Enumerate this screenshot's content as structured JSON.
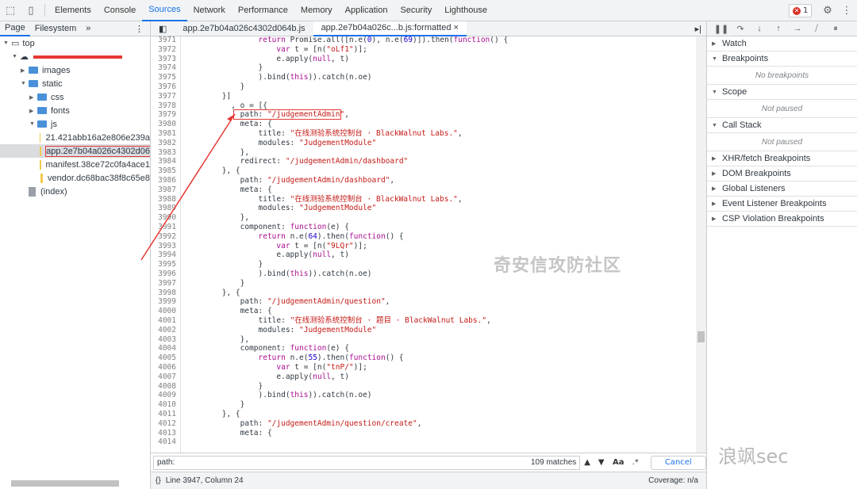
{
  "toolbar": {
    "tabs": [
      "Elements",
      "Console",
      "Sources",
      "Network",
      "Performance",
      "Memory",
      "Application",
      "Security",
      "Lighthouse"
    ],
    "active": "Sources",
    "error_count": "1"
  },
  "navigator": {
    "tabs": [
      "Page",
      "Filesystem"
    ],
    "more": "»",
    "tree": [
      {
        "label": "top",
        "type": "root",
        "depth": 0
      },
      {
        "label": "",
        "type": "folder-cloud",
        "depth": 1,
        "redacted": true
      },
      {
        "label": "images",
        "type": "folder",
        "depth": 2
      },
      {
        "label": "static",
        "type": "folder",
        "depth": 2
      },
      {
        "label": "css",
        "type": "folder",
        "depth": 3
      },
      {
        "label": "fonts",
        "type": "folder",
        "depth": 3
      },
      {
        "label": "js",
        "type": "folder",
        "depth": 3
      },
      {
        "label": "21.421abb16a2e806e239a",
        "type": "file",
        "depth": 4
      },
      {
        "label": "app.2e7b04a026c4302d06",
        "type": "file",
        "depth": 4,
        "selected": true
      },
      {
        "label": "manifest.38ce72c0fa4ace1",
        "type": "file",
        "depth": 4
      },
      {
        "label": "vendor.dc68bac38f8c65e8",
        "type": "file",
        "depth": 4
      },
      {
        "label": "(index)",
        "type": "file-gray",
        "depth": 2
      }
    ]
  },
  "editor": {
    "tabs": [
      {
        "label": "app.2e7b04a026c4302d064b.js",
        "active": false
      },
      {
        "label": "app.2e7b04a026c...b.js:formatted",
        "active": true,
        "close": "×"
      }
    ],
    "lines": [
      {
        "n": "3971",
        "t": "                return Promise.all([n.e(0), n.e(69)]).then(function() {"
      },
      {
        "n": "3972",
        "t": "                    var t = [n(\"oLf1\")];"
      },
      {
        "n": "3973",
        "t": "                    e.apply(null, t)"
      },
      {
        "n": "3974",
        "t": "                }"
      },
      {
        "n": "3975",
        "t": "                ).bind(this)).catch(n.oe)"
      },
      {
        "n": "3976",
        "t": "            }"
      },
      {
        "n": "3977",
        "t": "        }]"
      },
      {
        "n": "3978",
        "t": "          , o = [{"
      },
      {
        "n": "3979",
        "t": "            path: \"/judgementAdmin\","
      },
      {
        "n": "3980",
        "t": "            meta: {"
      },
      {
        "n": "3981",
        "t": "                title: \"在线测验系统控制台 · BlackWalnut Labs.\","
      },
      {
        "n": "3982",
        "t": "                modules: \"JudgementModule\""
      },
      {
        "n": "3983",
        "t": "            },"
      },
      {
        "n": "3984",
        "t": "            redirect: \"/judgementAdmin/dashboard\""
      },
      {
        "n": "3985",
        "t": "        }, {"
      },
      {
        "n": "3986",
        "t": "            path: \"/judgementAdmin/dashboard\","
      },
      {
        "n": "3987",
        "t": "            meta: {"
      },
      {
        "n": "3988",
        "t": "                title: \"在线测验系统控制台 · BlackWalnut Labs.\","
      },
      {
        "n": "3989",
        "t": "                modules: \"JudgementModule\""
      },
      {
        "n": "3990",
        "t": "            },"
      },
      {
        "n": "3991",
        "t": "            component: function(e) {"
      },
      {
        "n": "3992",
        "t": "                return n.e(64).then(function() {"
      },
      {
        "n": "3993",
        "t": "                    var t = [n(\"9LQr\")];"
      },
      {
        "n": "3994",
        "t": "                    e.apply(null, t)"
      },
      {
        "n": "3995",
        "t": "                }"
      },
      {
        "n": "3996",
        "t": "                ).bind(this)).catch(n.oe)"
      },
      {
        "n": "3997",
        "t": "            }"
      },
      {
        "n": "3998",
        "t": "        }, {"
      },
      {
        "n": "3999",
        "t": "            path: \"/judgementAdmin/question\","
      },
      {
        "n": "4000",
        "t": "            meta: {"
      },
      {
        "n": "4001",
        "t": "                title: \"在线测验系统控制台 · 题目 · BlackWalnut Labs.\","
      },
      {
        "n": "4002",
        "t": "                modules: \"JudgementModule\""
      },
      {
        "n": "4003",
        "t": "            },"
      },
      {
        "n": "4004",
        "t": "            component: function(e) {"
      },
      {
        "n": "4005",
        "t": "                return n.e(55).then(function() {"
      },
      {
        "n": "4006",
        "t": "                    var t = [n(\"tnP/\")];"
      },
      {
        "n": "4007",
        "t": "                    e.apply(null, t)"
      },
      {
        "n": "4008",
        "t": "                }"
      },
      {
        "n": "4009",
        "t": "                ).bind(this)).catch(n.oe)"
      },
      {
        "n": "4010",
        "t": "            }"
      },
      {
        "n": "4011",
        "t": "        }, {"
      },
      {
        "n": "4012",
        "t": "            path: \"/judgementAdmin/question/create\","
      },
      {
        "n": "4013",
        "t": "            meta: {"
      },
      {
        "n": "4014",
        "t": ""
      }
    ],
    "watermark": "奇安信攻防社区"
  },
  "search": {
    "value": "path:",
    "matches": "109 matches",
    "case_label": "Aa",
    "regex_label": ".*",
    "cancel": "Cancel"
  },
  "status": {
    "position": "Line 3947, Column 24",
    "coverage": "Coverage: n/a"
  },
  "debugger": {
    "sections": [
      {
        "label": "Watch",
        "empty": ""
      },
      {
        "label": "Breakpoints",
        "empty": "No breakpoints"
      },
      {
        "label": "Scope",
        "empty": "Not paused"
      },
      {
        "label": "Call Stack",
        "empty": "Not paused"
      },
      {
        "label": "XHR/fetch Breakpoints",
        "empty": ""
      },
      {
        "label": "DOM Breakpoints",
        "empty": ""
      },
      {
        "label": "Global Listeners",
        "empty": ""
      },
      {
        "label": "Event Listener Breakpoints",
        "empty": ""
      },
      {
        "label": "CSP Violation Breakpoints",
        "empty": ""
      }
    ]
  },
  "brand_watermark": "浪飒sec"
}
